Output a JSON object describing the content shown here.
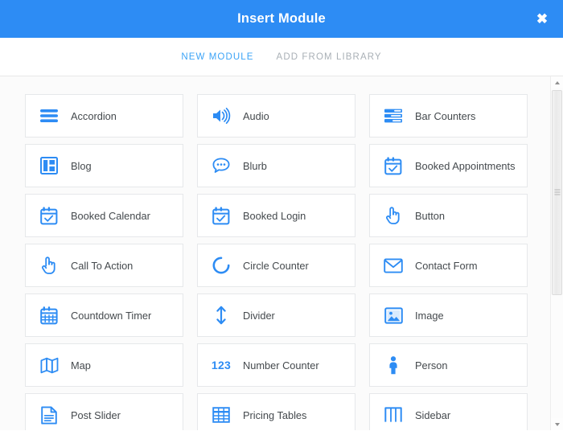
{
  "header": {
    "title": "Insert Module",
    "close_label": "✖",
    "bg_color": "#2d8cf4"
  },
  "tabs": [
    {
      "label": "NEW MODULE",
      "active": true,
      "color": "#3ba3f7"
    },
    {
      "label": "ADD FROM LIBRARY",
      "active": false,
      "color": "#a9b0b6"
    }
  ],
  "modules": [
    {
      "label": "Accordion",
      "icon": "accordion-icon"
    },
    {
      "label": "Audio",
      "icon": "speaker-icon"
    },
    {
      "label": "Bar Counters",
      "icon": "bar-counters-icon"
    },
    {
      "label": "Blog",
      "icon": "layout-blog-icon"
    },
    {
      "label": "Blurb",
      "icon": "speech-bubble-icon"
    },
    {
      "label": "Booked Appointments",
      "icon": "calendar-check-icon"
    },
    {
      "label": "Booked Calendar",
      "icon": "calendar-check-icon"
    },
    {
      "label": "Booked Login",
      "icon": "calendar-check-icon"
    },
    {
      "label": "Button",
      "icon": "pointing-hand-icon"
    },
    {
      "label": "Call To Action",
      "icon": "pointing-hand-icon"
    },
    {
      "label": "Circle Counter",
      "icon": "circle-arc-icon"
    },
    {
      "label": "Contact Form",
      "icon": "envelope-icon"
    },
    {
      "label": "Countdown Timer",
      "icon": "calendar-grid-icon"
    },
    {
      "label": "Divider",
      "icon": "vertical-arrows-icon"
    },
    {
      "label": "Image",
      "icon": "picture-icon"
    },
    {
      "label": "Map",
      "icon": "folded-map-icon"
    },
    {
      "label": "Number Counter",
      "icon": "number-123-icon",
      "icon_text": "123"
    },
    {
      "label": "Person",
      "icon": "person-icon"
    },
    {
      "label": "Post Slider",
      "icon": "document-lines-icon"
    },
    {
      "label": "Pricing Tables",
      "icon": "table-grid-icon"
    },
    {
      "label": "Sidebar",
      "icon": "sidebar-columns-icon"
    }
  ],
  "scrollbar": {
    "up_arrow": "▲",
    "down_arrow": "▼"
  }
}
